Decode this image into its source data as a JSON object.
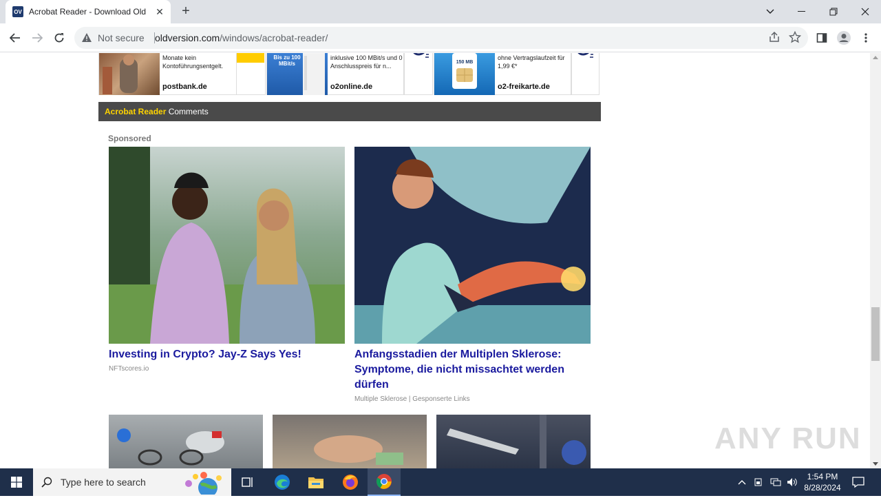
{
  "browser": {
    "tab_favicon": "OV",
    "tab_title": "Acrobat Reader - Download Old",
    "security_label": "Not secure",
    "url_host": "oldversion.com",
    "url_path": "/windows/acrobat-reader/"
  },
  "ads_strip": [
    {
      "text": "Monate kein Kontoführungsentgelt.",
      "domain": "postbank.de"
    },
    {
      "text": "inklusive 100 MBit/s und 0 Anschlusspreis für n...",
      "domain": "o2online.de",
      "badge": "Bis zu 100 MBit/s"
    },
    {
      "text": "ohne Vertragslaufzeit für 1,99 €*",
      "domain": "o2-freikarte.de",
      "badge": "150 MB"
    }
  ],
  "comments": {
    "app_name": "Acrobat Reader",
    "label": "Comments"
  },
  "sponsored_label": "Sponsored",
  "sponsored_items": [
    {
      "title": "Investing in Crypto? Jay-Z Says Yes!",
      "source": "NFTscores.io"
    },
    {
      "title": "Anfangsstadien der Multiplen Sklerose: Symptome, die nicht missachtet werden dürfen",
      "source": "Multiple Sklerose | Gesponserte Links"
    }
  ],
  "watermark": "ANY RUN",
  "taskbar": {
    "search_placeholder": "Type here to search",
    "time": "1:54 PM",
    "date": "8/28/2024"
  },
  "colors": {
    "comments_bar_bg": "#4a4a4a",
    "comments_app_name": "#ffd400",
    "ad_title": "#1a1a9e",
    "taskbar_bg": "#1f2f4a"
  }
}
